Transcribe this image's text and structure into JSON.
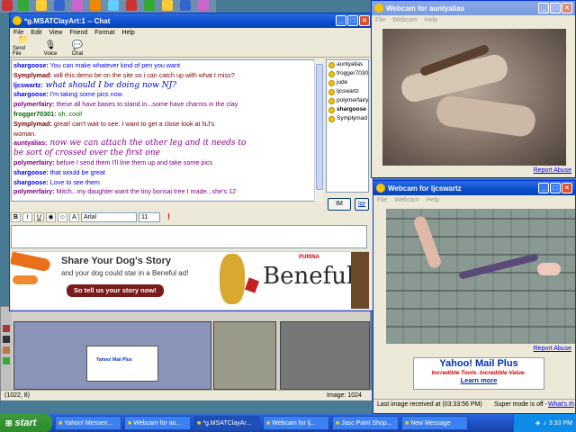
{
  "chat_window": {
    "title": "*g.MSATClayArt:1 -- Chat",
    "menu": [
      "File",
      "Edit",
      "View",
      "Friend",
      "Format",
      "Help"
    ],
    "toolbar": [
      {
        "label": "Send File",
        "icon": "send-file-icon"
      },
      {
        "label": "Voice",
        "icon": "voice-icon"
      },
      {
        "label": "Chat",
        "icon": "chat-icon"
      }
    ],
    "messages": [
      {
        "nick": "sharg",
        "name": "shargoose:",
        "text": " You can make whatever kind of pen you want",
        "big": false
      },
      {
        "nick": "symp",
        "name": "Symplymad:",
        "text": " will this demo be on the site so i can catch up with what I miss?",
        "big": false
      },
      {
        "nick": "ljcs",
        "name": "ljcswartz:",
        "text": " what should I be doing now NJ?",
        "big": true
      },
      {
        "nick": "sharg",
        "name": "shargoose:",
        "text": " I'm taking some pics now",
        "big": false
      },
      {
        "nick": "poly",
        "name": "polymerfairy:",
        "text": " these all have bases to stand in...some have charms in the clay",
        "big": false
      },
      {
        "nick": "frog",
        "name": "frogger70301:",
        "text": " oh, cool!",
        "big": false
      },
      {
        "nick": "symp",
        "name": "Symplymad:",
        "text": " great! can't wait to see. I want to get a close look at NJ's",
        "big": false
      },
      {
        "nick": "symp",
        "name": "",
        "text": "   woman.",
        "big": false
      },
      {
        "nick": "aunt",
        "name": "auntyalias:",
        "text": " now we can attach the other leg and it needs to",
        "big": true
      },
      {
        "nick": "aunt",
        "name": "",
        "text": "   be sort of crossed over the first one",
        "big": true
      },
      {
        "nick": "poly",
        "name": "polymerfairy:",
        "text": " before I send them I'll line them up and take some pics",
        "big": false
      },
      {
        "nick": "sharg",
        "name": "shargoose:",
        "text": " that would be great",
        "big": false
      },
      {
        "nick": "sharg",
        "name": "shargoose:",
        "text": " Love to see them",
        "big": false
      },
      {
        "nick": "poly",
        "name": "polymerfairy:",
        "text": " Mitch...my daughter want the tiny bonsai tree I made...she's 12",
        "big": false
      }
    ],
    "users": [
      {
        "name": "auntyalias",
        "bold": false
      },
      {
        "name": "frogger7030",
        "bold": false
      },
      {
        "name": "jude",
        "bold": false
      },
      {
        "name": "ljcswartz",
        "bold": false
      },
      {
        "name": "polymerfairy",
        "bold": false
      },
      {
        "name": "shargoose",
        "bold": true
      },
      {
        "name": "Symplymad",
        "bold": false
      }
    ],
    "format": {
      "font": "Arial",
      "size": "11"
    },
    "buttons": {
      "im": "IM",
      "ignore": "Igr"
    },
    "ad": {
      "line1": "Share Your Dog's Story",
      "line2": "and your dog could star in a Beneful ad!",
      "cta": "So tell us your story now!",
      "brand_small": "PURINA",
      "brand": "Beneful"
    }
  },
  "cam1": {
    "title": "Webcam for auntyalias",
    "menu": [
      "File",
      "Webcam",
      "Help"
    ],
    "report": "Report Abuse"
  },
  "cam2": {
    "title": "Webcam for ljcswartz",
    "menu": [
      "File",
      "Webcam",
      "Help"
    ],
    "report": "Report Abuse",
    "ad_title": "Yahoo! Mail Plus",
    "ad_sub": "Incredible Tools. Incredible Value.",
    "ad_link": "Learn more",
    "status": "Last image received at (03:33:56 PM)",
    "super": "Super mode is off -",
    "whats": "What's th"
  },
  "psp": {
    "coords": "(1022, 8)",
    "image_label": "Image: 1024",
    "thumb_text": "Yahoo! Mail Plus"
  },
  "taskbar": {
    "start": "start",
    "tasks": [
      {
        "label": "Yahoo! Messen...",
        "active": false
      },
      {
        "label": "Webcam for au...",
        "active": false
      },
      {
        "label": "*g.MSATClayAr...",
        "active": true
      },
      {
        "label": "Webcam for lj...",
        "active": false
      },
      {
        "label": "Jasc Paint Shop...",
        "active": false
      },
      {
        "label": "New Message",
        "active": false
      }
    ],
    "clock": "3:33 PM"
  }
}
